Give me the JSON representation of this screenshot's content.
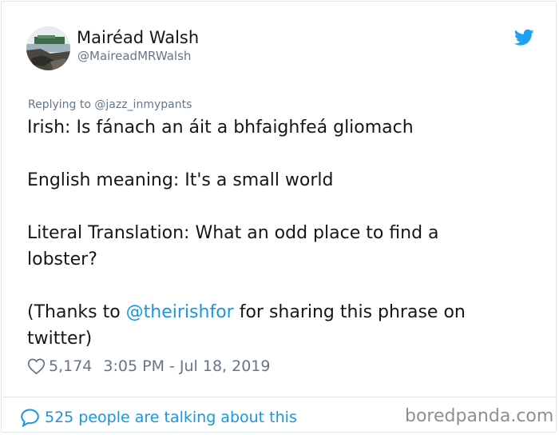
{
  "author": {
    "name": "Mairéad Walsh",
    "handle": "@MaireadMRWalsh"
  },
  "reply": {
    "prefix": "Replying to ",
    "handle": "@jazz_inmypants"
  },
  "tweet": {
    "line1": "Irish: Is fánach an áit a bhfaighfeá gliomach",
    "line2": "English meaning: It's a small world",
    "line3": "Literal Translation: What an odd place to find a lobster?",
    "line4_prefix": "(Thanks to ",
    "line4_mention": "@theirishfor",
    "line4_suffix": " for sharing this phrase on twitter)"
  },
  "meta": {
    "likes": "5,174",
    "timestamp": "3:05 PM - Jul 18, 2019"
  },
  "footer": {
    "talking": "525 people are talking about this"
  },
  "watermark": "boredpanda.com",
  "colors": {
    "twitter_blue": "#1da1f2",
    "link_blue": "#1b95e0",
    "muted": "#657786"
  },
  "icons": [
    "twitter-bird-icon",
    "heart-icon",
    "speech-bubble-icon"
  ]
}
